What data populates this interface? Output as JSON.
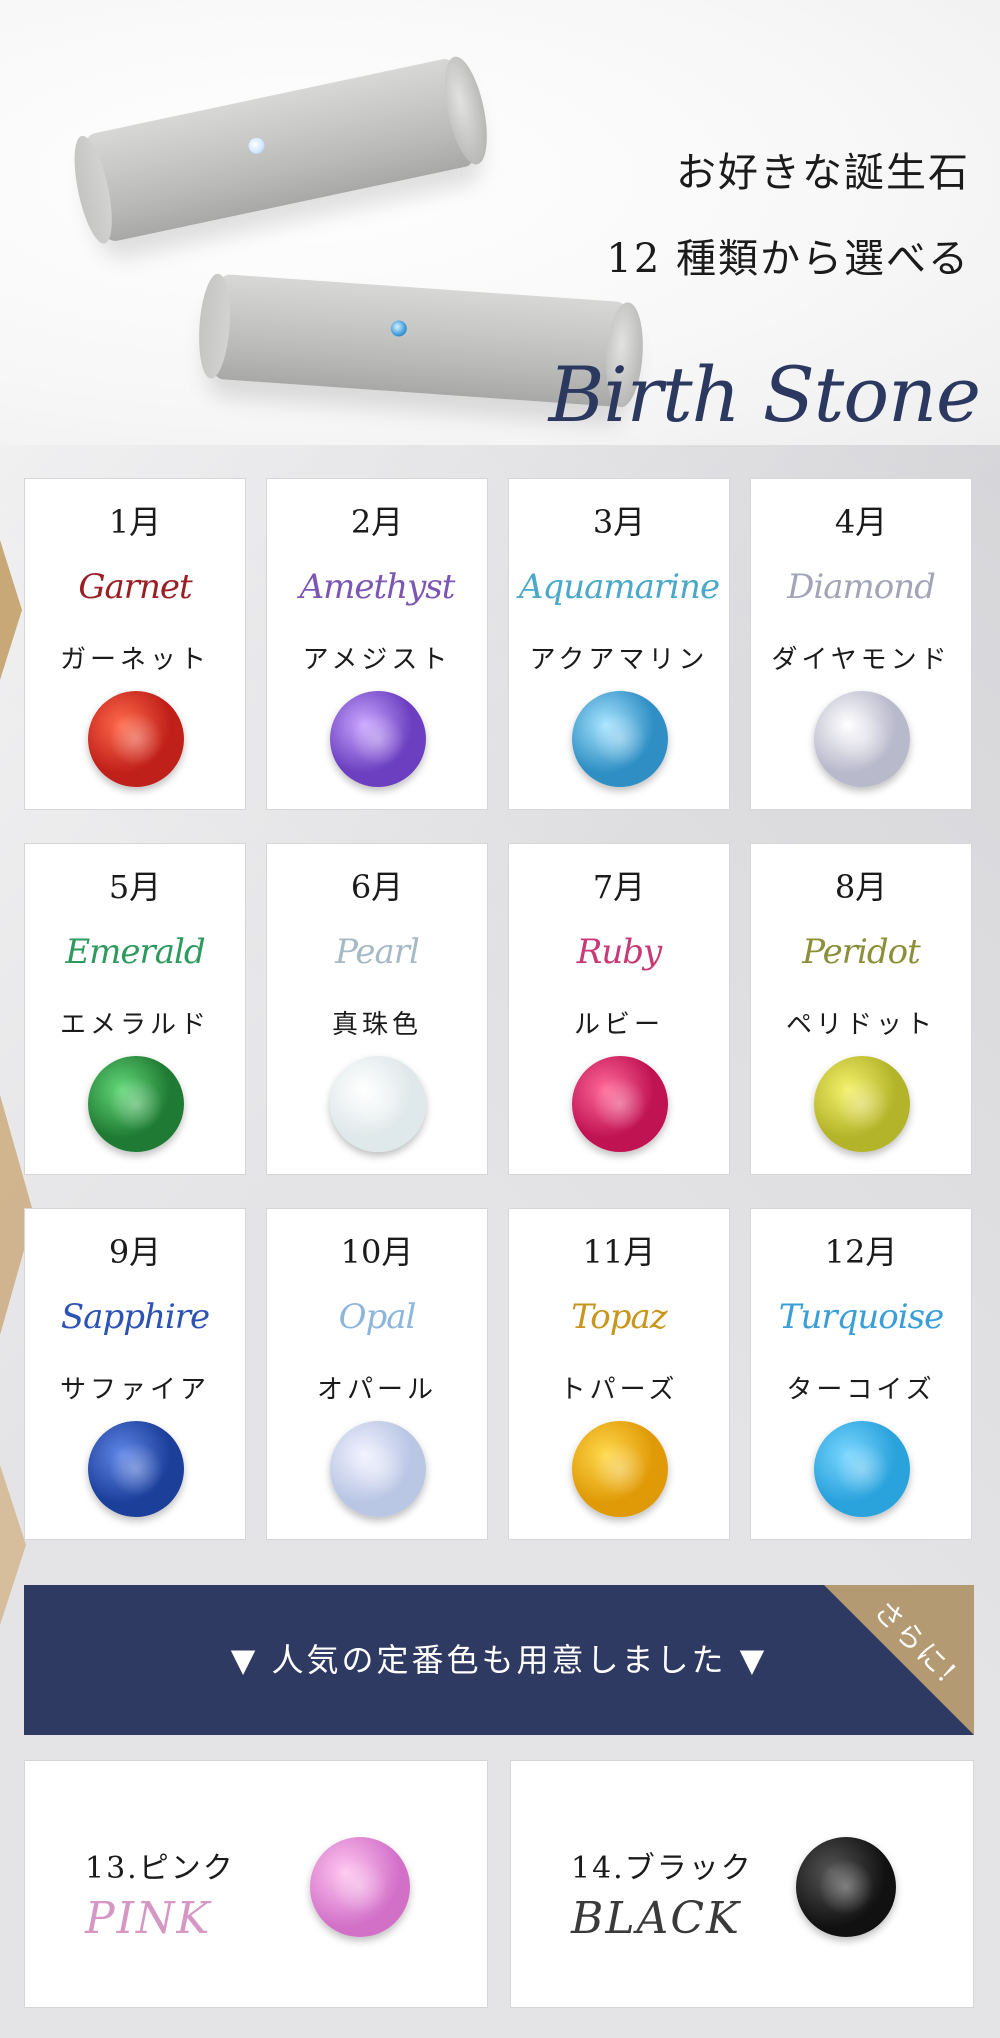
{
  "hero": {
    "line1": "お好きな誕生石",
    "line2": "12 種類から選べる",
    "logo": "Birth Stone"
  },
  "stones": [
    {
      "month": "1月",
      "en": "Garnet",
      "jp": "ガーネット",
      "en_color": "#9a1f25",
      "stone_color": "#c0201a",
      "stone_light": "#ff6a4a"
    },
    {
      "month": "2月",
      "en": "Amethyst",
      "jp": "アメジスト",
      "en_color": "#7d56b4",
      "stone_color": "#6c3fc0",
      "stone_light": "#c9a6ff"
    },
    {
      "month": "3月",
      "en": "Aquamarine",
      "jp": "アクアマリン",
      "en_color": "#4aa8c8",
      "stone_color": "#2f8fc4",
      "stone_light": "#a8e4ff"
    },
    {
      "month": "4月",
      "en": "Diamond",
      "jp": "ダイヤモンド",
      "en_color": "#a4a4b8",
      "stone_color": "#b9b9cc",
      "stone_light": "#ffffff"
    },
    {
      "month": "5月",
      "en": "Emerald",
      "jp": "エメラルド",
      "en_color": "#2e9a5e",
      "stone_color": "#1f7a33",
      "stone_light": "#63d879"
    },
    {
      "month": "6月",
      "en": "Pearl",
      "jp": "真珠色",
      "en_color": "#a5b9c6",
      "stone_color": "#dfe8ea",
      "stone_light": "#ffffff"
    },
    {
      "month": "7月",
      "en": "Ruby",
      "jp": "ルビー",
      "en_color": "#c73a78",
      "stone_color": "#c01352",
      "stone_light": "#ff6a9a"
    },
    {
      "month": "8月",
      "en": "Peridot",
      "jp": "ペリドット",
      "en_color": "#8c8f3a",
      "stone_color": "#b4b42a",
      "stone_light": "#f4f06a"
    },
    {
      "month": "9月",
      "en": "Sapphire",
      "jp": "サファイア",
      "en_color": "#2c52b4",
      "stone_color": "#1c3f9a",
      "stone_light": "#5f86e8"
    },
    {
      "month": "10月",
      "en": "Opal",
      "jp": "オパール",
      "en_color": "#8db6dc",
      "stone_color": "#b9c6e4",
      "stone_light": "#f2f2ff"
    },
    {
      "month": "11月",
      "en": "Topaz",
      "jp": "トパーズ",
      "en_color": "#c8961c",
      "stone_color": "#e09a08",
      "stone_light": "#ffd84a"
    },
    {
      "month": "12月",
      "en": "Turquoise",
      "jp": "ターコイズ",
      "en_color": "#3a9fd8",
      "stone_color": "#2aa2dc",
      "stone_light": "#79d6ff"
    }
  ],
  "banner": {
    "label": "▼ 人気の定番色も用意しました ▼",
    "corner": "さらに!"
  },
  "extras": [
    {
      "num": "13.ピンク",
      "en": "PINK",
      "en_color": "#d598c4",
      "stone_color": "#d270c8",
      "stone_light": "#ffc6f0"
    },
    {
      "num": "14.ブラック",
      "en": "BLACK",
      "en_color": "#3a3a3a",
      "stone_color": "#111111",
      "stone_light": "#555555"
    }
  ]
}
